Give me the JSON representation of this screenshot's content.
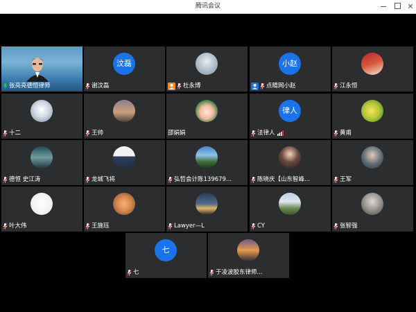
{
  "window": {
    "title": "腾讯会议"
  },
  "colors": {
    "avatar_blue": "#1a73e8",
    "tile_bg": "#2b2d2f",
    "host_badge": "#e88a2e",
    "cohost_badge": "#2a6fd8"
  },
  "participants": [
    {
      "name": "张亮亮德恒律师",
      "avatar": "video",
      "mic": "on"
    },
    {
      "name": "谢汶磊",
      "avatar": "text",
      "avatar_text": "汶磊",
      "mic": "muted"
    },
    {
      "name": "杜永博",
      "avatar": "photo-building",
      "mic": "muted",
      "badge": "host"
    },
    {
      "name": "点睛网小赵",
      "avatar": "text",
      "avatar_text": "小赵",
      "mic": "muted",
      "badge": "cohost"
    },
    {
      "name": "江永恒",
      "avatar": "photo-red",
      "mic": "muted"
    },
    {
      "name": "十二",
      "avatar": "photo-winter",
      "mic": "muted"
    },
    {
      "name": "王帅",
      "avatar": "photo-sunset",
      "mic": "muted"
    },
    {
      "name": "邵娟娟",
      "avatar": "photo-cartoon",
      "mic": "none"
    },
    {
      "name": "法律人",
      "avatar": "text",
      "avatar_text": "律人",
      "mic": "muted",
      "signal": true
    },
    {
      "name": "黄甫",
      "avatar": "photo-lemon",
      "mic": "muted"
    },
    {
      "name": "德恒 史江涛",
      "avatar": "photo-forest",
      "mic": "muted"
    },
    {
      "name": "龙城飞将",
      "avatar": "photo-suit",
      "mic": "muted"
    },
    {
      "name": "弘哲会计陈139679...",
      "avatar": "photo-mountain",
      "mic": "muted"
    },
    {
      "name": "陈晓庆【山东智峰...",
      "avatar": "photo-woman",
      "mic": "muted"
    },
    {
      "name": "王军",
      "avatar": "photo-man",
      "mic": "muted"
    },
    {
      "name": "叶大伟",
      "avatar": "photo-sketch",
      "mic": "muted"
    },
    {
      "name": "王施珏",
      "avatar": "photo-cat",
      "mic": "muted"
    },
    {
      "name": "Lawyer—L",
      "avatar": "photo-night",
      "mic": "muted"
    },
    {
      "name": "CY",
      "avatar": "photo-landscape",
      "mic": "muted"
    },
    {
      "name": "张智强",
      "avatar": "photo-gray",
      "mic": "muted"
    },
    {
      "name": "七",
      "avatar": "text",
      "avatar_text": "七",
      "mic": "muted"
    },
    {
      "name": "于凌波胶东律师...",
      "avatar": "photo-dusk",
      "mic": "muted"
    }
  ]
}
